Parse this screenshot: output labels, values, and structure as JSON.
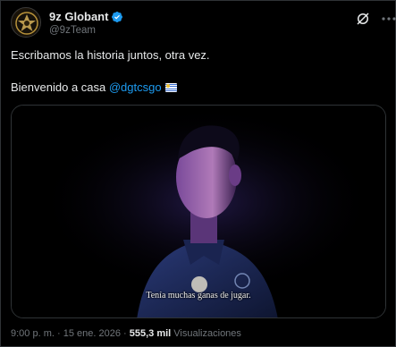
{
  "author": {
    "display_name": "9z Globant",
    "handle": "@9zTeam",
    "verified": true,
    "verified_color": "#1d9bf0"
  },
  "tweet": {
    "text_line1": "Escribamos la historia juntos, otra vez.",
    "text_line2_prefix": "Bienvenido a casa ",
    "mention": "@dgtcsgo",
    "flag": "uruguay-flag",
    "mention_color": "#1d9bf0"
  },
  "media": {
    "type": "video",
    "subtitle": "Tenía muchas ganas de jugar."
  },
  "footer": {
    "time": "9:00 p. m.",
    "separator1": "·",
    "date": "15 ene. 2026",
    "separator2": "·",
    "views_count": "555,3 mil",
    "views_label": "Visualizaciones"
  },
  "icons": {
    "grok": "grok-icon",
    "more": "more-options-icon",
    "verified": "verified-badge-icon"
  },
  "colors": {
    "background": "#000000",
    "text_primary": "#e7e9ea",
    "text_secondary": "#71767b",
    "border": "#2f3336",
    "accent": "#1d9bf0"
  }
}
